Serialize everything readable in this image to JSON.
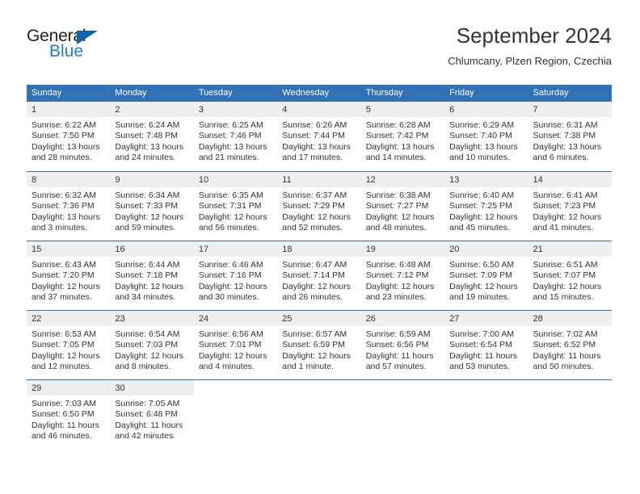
{
  "brand": {
    "name_top": "General",
    "name_bottom": "Blue",
    "triangle_color": "#1464a5",
    "blue_text_color": "#1f7ad4"
  },
  "header": {
    "title": "September 2024",
    "subtitle": "Chlumcany, Plzen Region, Czechia"
  },
  "theme": {
    "header_bg": "#3171b5",
    "header_text": "#ffffff",
    "daynum_bg": "#efefef",
    "separator": "#2f6fae",
    "body_text": "#333333"
  },
  "weekday_headers": [
    "Sunday",
    "Monday",
    "Tuesday",
    "Wednesday",
    "Thursday",
    "Friday",
    "Saturday"
  ],
  "labels": {
    "sunrise_prefix": "Sunrise:",
    "sunset_prefix": "Sunset:",
    "daylight_prefix": "Daylight:"
  },
  "weeks": [
    [
      {
        "day": "1",
        "sunrise": "Sunrise: 6:22 AM",
        "sunset": "Sunset: 7:50 PM",
        "daylight_line1": "Daylight: 13 hours",
        "daylight_line2": "and 28 minutes."
      },
      {
        "day": "2",
        "sunrise": "Sunrise: 6:24 AM",
        "sunset": "Sunset: 7:48 PM",
        "daylight_line1": "Daylight: 13 hours",
        "daylight_line2": "and 24 minutes."
      },
      {
        "day": "3",
        "sunrise": "Sunrise: 6:25 AM",
        "sunset": "Sunset: 7:46 PM",
        "daylight_line1": "Daylight: 13 hours",
        "daylight_line2": "and 21 minutes."
      },
      {
        "day": "4",
        "sunrise": "Sunrise: 6:26 AM",
        "sunset": "Sunset: 7:44 PM",
        "daylight_line1": "Daylight: 13 hours",
        "daylight_line2": "and 17 minutes."
      },
      {
        "day": "5",
        "sunrise": "Sunrise: 6:28 AM",
        "sunset": "Sunset: 7:42 PM",
        "daylight_line1": "Daylight: 13 hours",
        "daylight_line2": "and 14 minutes."
      },
      {
        "day": "6",
        "sunrise": "Sunrise: 6:29 AM",
        "sunset": "Sunset: 7:40 PM",
        "daylight_line1": "Daylight: 13 hours",
        "daylight_line2": "and 10 minutes."
      },
      {
        "day": "7",
        "sunrise": "Sunrise: 6:31 AM",
        "sunset": "Sunset: 7:38 PM",
        "daylight_line1": "Daylight: 13 hours",
        "daylight_line2": "and 6 minutes."
      }
    ],
    [
      {
        "day": "8",
        "sunrise": "Sunrise: 6:32 AM",
        "sunset": "Sunset: 7:36 PM",
        "daylight_line1": "Daylight: 13 hours",
        "daylight_line2": "and 3 minutes."
      },
      {
        "day": "9",
        "sunrise": "Sunrise: 6:34 AM",
        "sunset": "Sunset: 7:33 PM",
        "daylight_line1": "Daylight: 12 hours",
        "daylight_line2": "and 59 minutes."
      },
      {
        "day": "10",
        "sunrise": "Sunrise: 6:35 AM",
        "sunset": "Sunset: 7:31 PM",
        "daylight_line1": "Daylight: 12 hours",
        "daylight_line2": "and 56 minutes."
      },
      {
        "day": "11",
        "sunrise": "Sunrise: 6:37 AM",
        "sunset": "Sunset: 7:29 PM",
        "daylight_line1": "Daylight: 12 hours",
        "daylight_line2": "and 52 minutes."
      },
      {
        "day": "12",
        "sunrise": "Sunrise: 6:38 AM",
        "sunset": "Sunset: 7:27 PM",
        "daylight_line1": "Daylight: 12 hours",
        "daylight_line2": "and 48 minutes."
      },
      {
        "day": "13",
        "sunrise": "Sunrise: 6:40 AM",
        "sunset": "Sunset: 7:25 PM",
        "daylight_line1": "Daylight: 12 hours",
        "daylight_line2": "and 45 minutes."
      },
      {
        "day": "14",
        "sunrise": "Sunrise: 6:41 AM",
        "sunset": "Sunset: 7:23 PM",
        "daylight_line1": "Daylight: 12 hours",
        "daylight_line2": "and 41 minutes."
      }
    ],
    [
      {
        "day": "15",
        "sunrise": "Sunrise: 6:43 AM",
        "sunset": "Sunset: 7:20 PM",
        "daylight_line1": "Daylight: 12 hours",
        "daylight_line2": "and 37 minutes."
      },
      {
        "day": "16",
        "sunrise": "Sunrise: 6:44 AM",
        "sunset": "Sunset: 7:18 PM",
        "daylight_line1": "Daylight: 12 hours",
        "daylight_line2": "and 34 minutes."
      },
      {
        "day": "17",
        "sunrise": "Sunrise: 6:46 AM",
        "sunset": "Sunset: 7:16 PM",
        "daylight_line1": "Daylight: 12 hours",
        "daylight_line2": "and 30 minutes."
      },
      {
        "day": "18",
        "sunrise": "Sunrise: 6:47 AM",
        "sunset": "Sunset: 7:14 PM",
        "daylight_line1": "Daylight: 12 hours",
        "daylight_line2": "and 26 minutes."
      },
      {
        "day": "19",
        "sunrise": "Sunrise: 6:48 AM",
        "sunset": "Sunset: 7:12 PM",
        "daylight_line1": "Daylight: 12 hours",
        "daylight_line2": "and 23 minutes."
      },
      {
        "day": "20",
        "sunrise": "Sunrise: 6:50 AM",
        "sunset": "Sunset: 7:09 PM",
        "daylight_line1": "Daylight: 12 hours",
        "daylight_line2": "and 19 minutes."
      },
      {
        "day": "21",
        "sunrise": "Sunrise: 6:51 AM",
        "sunset": "Sunset: 7:07 PM",
        "daylight_line1": "Daylight: 12 hours",
        "daylight_line2": "and 15 minutes."
      }
    ],
    [
      {
        "day": "22",
        "sunrise": "Sunrise: 6:53 AM",
        "sunset": "Sunset: 7:05 PM",
        "daylight_line1": "Daylight: 12 hours",
        "daylight_line2": "and 12 minutes."
      },
      {
        "day": "23",
        "sunrise": "Sunrise: 6:54 AM",
        "sunset": "Sunset: 7:03 PM",
        "daylight_line1": "Daylight: 12 hours",
        "daylight_line2": "and 8 minutes."
      },
      {
        "day": "24",
        "sunrise": "Sunrise: 6:56 AM",
        "sunset": "Sunset: 7:01 PM",
        "daylight_line1": "Daylight: 12 hours",
        "daylight_line2": "and 4 minutes."
      },
      {
        "day": "25",
        "sunrise": "Sunrise: 6:57 AM",
        "sunset": "Sunset: 6:59 PM",
        "daylight_line1": "Daylight: 12 hours",
        "daylight_line2": "and 1 minute."
      },
      {
        "day": "26",
        "sunrise": "Sunrise: 6:59 AM",
        "sunset": "Sunset: 6:56 PM",
        "daylight_line1": "Daylight: 11 hours",
        "daylight_line2": "and 57 minutes."
      },
      {
        "day": "27",
        "sunrise": "Sunrise: 7:00 AM",
        "sunset": "Sunset: 6:54 PM",
        "daylight_line1": "Daylight: 11 hours",
        "daylight_line2": "and 53 minutes."
      },
      {
        "day": "28",
        "sunrise": "Sunrise: 7:02 AM",
        "sunset": "Sunset: 6:52 PM",
        "daylight_line1": "Daylight: 11 hours",
        "daylight_line2": "and 50 minutes."
      }
    ],
    [
      {
        "day": "29",
        "sunrise": "Sunrise: 7:03 AM",
        "sunset": "Sunset: 6:50 PM",
        "daylight_line1": "Daylight: 11 hours",
        "daylight_line2": "and 46 minutes."
      },
      {
        "day": "30",
        "sunrise": "Sunrise: 7:05 AM",
        "sunset": "Sunset: 6:48 PM",
        "daylight_line1": "Daylight: 11 hours",
        "daylight_line2": "and 42 minutes."
      },
      {
        "day": "",
        "sunrise": "",
        "sunset": "",
        "daylight_line1": "",
        "daylight_line2": ""
      },
      {
        "day": "",
        "sunrise": "",
        "sunset": "",
        "daylight_line1": "",
        "daylight_line2": ""
      },
      {
        "day": "",
        "sunrise": "",
        "sunset": "",
        "daylight_line1": "",
        "daylight_line2": ""
      },
      {
        "day": "",
        "sunrise": "",
        "sunset": "",
        "daylight_line1": "",
        "daylight_line2": ""
      },
      {
        "day": "",
        "sunrise": "",
        "sunset": "",
        "daylight_line1": "",
        "daylight_line2": ""
      }
    ]
  ]
}
